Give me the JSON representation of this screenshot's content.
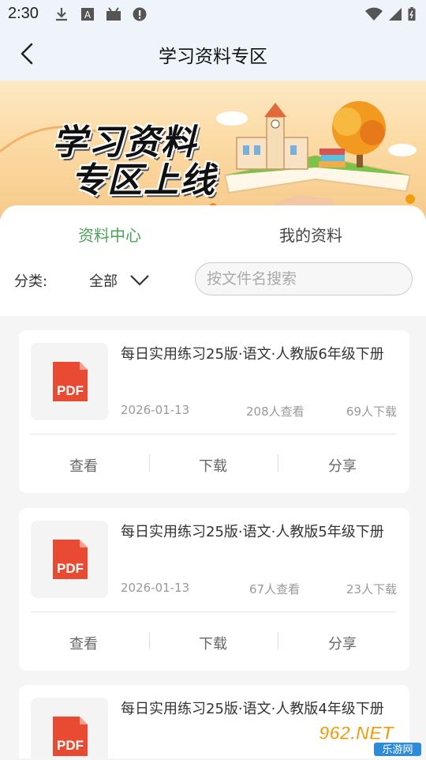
{
  "status_bar": {
    "time": "2:30"
  },
  "header": {
    "title": "学习资料专区"
  },
  "banner": {
    "line1": "学习资料",
    "line2": "专区上线"
  },
  "tabs": [
    {
      "label": "资料中心",
      "active": true
    },
    {
      "label": "我的资料",
      "active": false
    }
  ],
  "filter": {
    "label": "分类:",
    "value": "全部"
  },
  "search": {
    "placeholder": "按文件名搜索"
  },
  "documents": [
    {
      "title": "每日实用练习25版·语文·人教版6年级下册",
      "date": "2026-01-13",
      "views": "208人查看",
      "downloads": "69人下载"
    },
    {
      "title": "每日实用练习25版·语文·人教版5年级下册",
      "date": "2026-01-13",
      "views": "67人查看",
      "downloads": "23人下载"
    },
    {
      "title": "每日实用练习25版·语文·人教版4年级下册",
      "date": "",
      "views": "",
      "downloads": ""
    }
  ],
  "actions": {
    "view": "查看",
    "download": "下载",
    "share": "分享"
  },
  "icon_label": "PDF",
  "watermark": {
    "brand": "962.NET",
    "sub": "乐游网"
  },
  "colors": {
    "accent": "#4aa356",
    "pdf_red": "#e84a32"
  }
}
